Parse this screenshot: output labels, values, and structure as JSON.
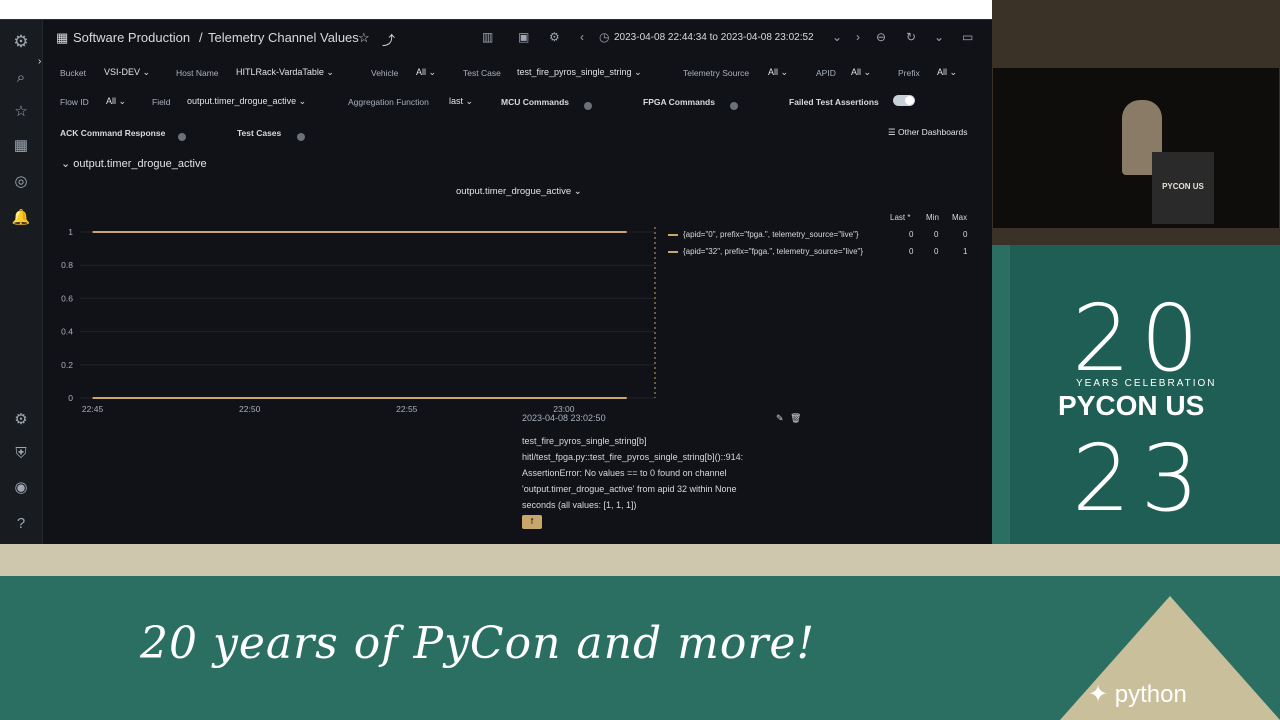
{
  "header": {
    "folder": "Software Production",
    "separator": "/",
    "title": "Telemetry Channel Values",
    "time_range": "2023-04-08 22:44:34 to 2023-04-08 23:02:52"
  },
  "filters_row1": [
    {
      "label": "Bucket",
      "value": "VSI-DEV"
    },
    {
      "label": "Host Name",
      "value": "HITLRack-VardaTable"
    },
    {
      "label": "Vehicle",
      "value": "All"
    },
    {
      "label": "Test Case",
      "value": "test_fire_pyros_single_string"
    },
    {
      "label": "Telemetry Source",
      "value": "All"
    },
    {
      "label": "APID",
      "value": "All"
    },
    {
      "label": "Prefix",
      "value": "All"
    }
  ],
  "filters_row2": {
    "flow_id_label": "Flow ID",
    "flow_id_value": "All",
    "field_label": "Field",
    "field_value": "output.timer_drogue_active",
    "agg_label": "Aggregation Function",
    "agg_value": "last",
    "mcu_label": "MCU Commands",
    "fpga_label": "FPGA Commands",
    "failed_label": "Failed Test Assertions"
  },
  "filters_row3": {
    "ack_label": "ACK Command Response",
    "test_cases_label": "Test Cases",
    "other_dashboards": "Other Dashboards"
  },
  "row_title": "output.timer_drogue_active",
  "panel_title": "output.timer_drogue_active",
  "legend": {
    "headers": [
      "Last *",
      "Min",
      "Max"
    ],
    "rows": [
      {
        "name": "{apid=\"0\", prefix=\"fpga.\", telemetry_source=\"live\"}",
        "last": "0",
        "min": "0",
        "max": "0"
      },
      {
        "name": "{apid=\"32\", prefix=\"fpga.\", telemetry_source=\"live\"}",
        "last": "0",
        "min": "0",
        "max": "1"
      }
    ]
  },
  "annotation": {
    "time": "2023-04-08 23:02:50",
    "lines": [
      "test_fire_pyros_single_string[b]",
      "hitl/test_fpga.py::test_fire_pyros_single_string[b]()::914:",
      "AssertionError: No values == to 0 found on channel",
      "'output.timer_drogue_active' from apid 32 within None",
      "seconds (all values: [1, 1, 1])"
    ],
    "tag": "f"
  },
  "chart_data": {
    "type": "line",
    "title": "output.timer_drogue_active",
    "x_ticks": [
      "22:45",
      "22:50",
      "22:55",
      "23:00"
    ],
    "y_ticks": [
      "0",
      "0.2",
      "0.4",
      "0.6",
      "0.8",
      "1"
    ],
    "ylim": [
      0,
      1
    ],
    "series": [
      {
        "name": "{apid=\"0\", prefix=\"fpga.\", telemetry_source=\"live\"}",
        "x": [
          "22:45",
          "23:02"
        ],
        "values": [
          0,
          0
        ],
        "color": "#c7a76b"
      },
      {
        "name": "{apid=\"32\", prefix=\"fpga.\", telemetry_source=\"live\"}",
        "x": [
          "22:45",
          "23:02"
        ],
        "values": [
          1,
          1
        ],
        "color": "#c7a76b"
      }
    ]
  },
  "slide": {
    "tagline": "20 years of PyCon and more!",
    "years_top": "20",
    "celebration": "YEARS CELEBRATION",
    "pycon": "PYCON US",
    "years_bottom": "23",
    "podium": "PYCON US",
    "python_logo_text": "python"
  },
  "colors": {
    "accent": "#c7a76b",
    "panel_bg": "#111217",
    "slide_green": "#2b6f63"
  }
}
